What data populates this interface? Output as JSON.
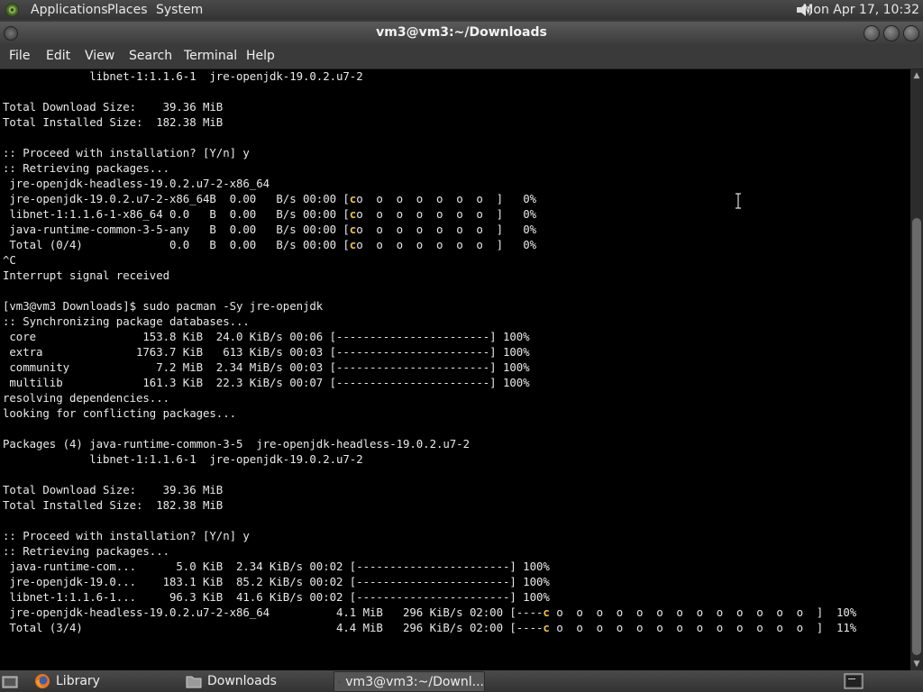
{
  "top_panel": {
    "menus": [
      "Applications",
      "Places",
      "System"
    ],
    "clock": "Mon Apr 17, 10:32",
    "icons": {
      "logo": "gnome-foot-icon",
      "volume": "speaker-volume-icon"
    }
  },
  "window": {
    "title": "vm3@vm3:~/Downloads",
    "menus": [
      "File",
      "Edit",
      "View",
      "Search",
      "Terminal",
      "Help"
    ]
  },
  "terminal": {
    "accent": "#f0c040",
    "lines": [
      "             libnet-1:1.1.6-1  jre-openjdk-19.0.2.u7-2",
      "",
      "Total Download Size:    39.36 MiB",
      "Total Installed Size:  182.38 MiB",
      "",
      ":: Proceed with installation? [Y/n] y",
      ":: Retrieving packages...",
      " jre-openjdk-headless-19.0.2.u7-2-x86_64",
      " jre-openjdk-19.0.2.u7-2-x86_64B  0.00   B/s 00:00 [{c}o  o  o  o  o  o  o  ]   0%",
      " libnet-1:1.1.6-1-x86_64 0.0   B  0.00   B/s 00:00 [{c}o  o  o  o  o  o  o  ]   0%",
      " java-runtime-common-3-5-any   B  0.00   B/s 00:00 [{c}o  o  o  o  o  o  o  ]   0%",
      " Total (0/4)             0.0   B  0.00   B/s 00:00 [{c}o  o  o  o  o  o  o  ]   0%",
      "^C",
      "Interrupt signal received",
      "",
      "[vm3@vm3 Downloads]$ sudo pacman -Sy jre-openjdk",
      ":: Synchronizing package databases...",
      " core                153.8 KiB  24.0 KiB/s 00:06 [-----------------------] 100%",
      " extra              1763.7 KiB   613 KiB/s 00:03 [-----------------------] 100%",
      " community             7.2 MiB  2.34 MiB/s 00:03 [-----------------------] 100%",
      " multilib            161.3 KiB  22.3 KiB/s 00:07 [-----------------------] 100%",
      "resolving dependencies...",
      "looking for conflicting packages...",
      "",
      "Packages (4) java-runtime-common-3-5  jre-openjdk-headless-19.0.2.u7-2",
      "             libnet-1:1.1.6-1  jre-openjdk-19.0.2.u7-2",
      "",
      "Total Download Size:    39.36 MiB",
      "Total Installed Size:  182.38 MiB",
      "",
      ":: Proceed with installation? [Y/n] y",
      ":: Retrieving packages...",
      " java-runtime-com...      5.0 KiB  2.34 KiB/s 00:02 [-----------------------] 100%",
      " jre-openjdk-19.0...    183.1 KiB  85.2 KiB/s 00:02 [-----------------------] 100%",
      " libnet-1:1.1.6-1...     96.3 KiB  41.6 KiB/s 00:02 [-----------------------] 100%",
      " jre-openjdk-headless-19.0.2.u7-2-x86_64          4.1 MiB   296 KiB/s 02:00 [----{c} o  o  o  o  o  o  o  o  o  o  o  o  o  ]  10%",
      " Total (3/4)                                      4.4 MiB   296 KiB/s 02:00 [----{c} o  o  o  o  o  o  o  o  o  o  o  o  o  ]  11%"
    ]
  },
  "taskbar": {
    "items": [
      {
        "label": "",
        "icon": "show-desktop-icon"
      },
      {
        "label": "Library",
        "icon": "firefox-icon"
      },
      {
        "label": "Downloads",
        "icon": "folder-icon"
      },
      {
        "label": "vm3@vm3:~/Downl...",
        "icon": "terminal-icon",
        "active": true
      }
    ],
    "tray_icon": "workspace-switcher-icon"
  }
}
